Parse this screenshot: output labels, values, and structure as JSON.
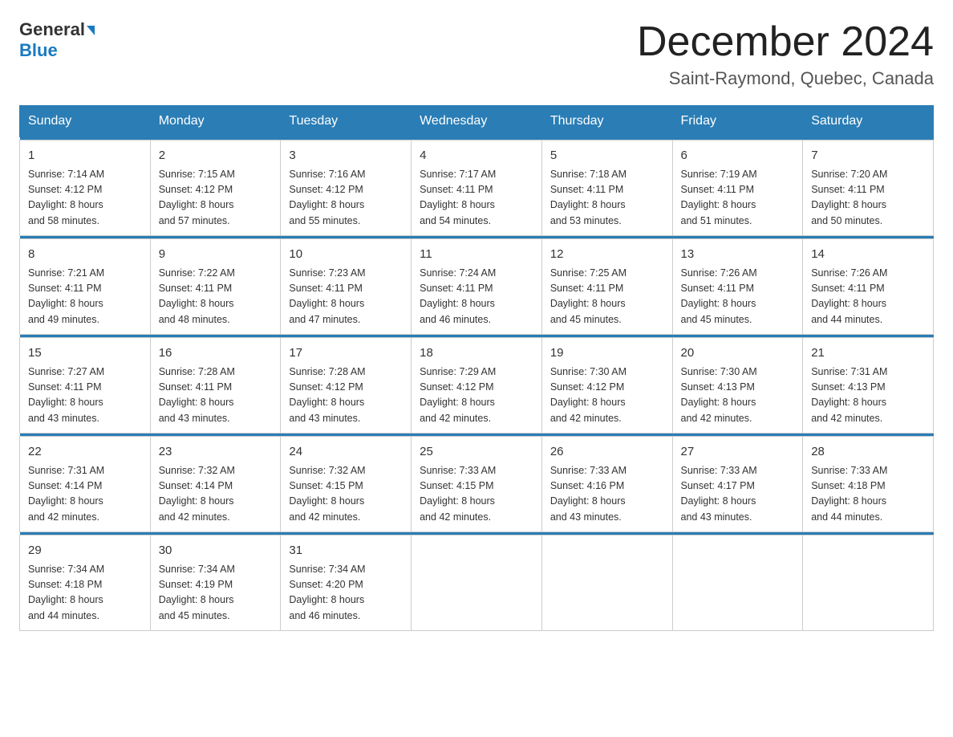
{
  "header": {
    "logo_line1": "General",
    "logo_line2": "Blue",
    "title": "December 2024",
    "subtitle": "Saint-Raymond, Quebec, Canada"
  },
  "weekdays": [
    "Sunday",
    "Monday",
    "Tuesday",
    "Wednesday",
    "Thursday",
    "Friday",
    "Saturday"
  ],
  "weeks": [
    [
      {
        "day": "1",
        "sunrise": "7:14 AM",
        "sunset": "4:12 PM",
        "daylight": "8 hours and 58 minutes."
      },
      {
        "day": "2",
        "sunrise": "7:15 AM",
        "sunset": "4:12 PM",
        "daylight": "8 hours and 57 minutes."
      },
      {
        "day": "3",
        "sunrise": "7:16 AM",
        "sunset": "4:12 PM",
        "daylight": "8 hours and 55 minutes."
      },
      {
        "day": "4",
        "sunrise": "7:17 AM",
        "sunset": "4:11 PM",
        "daylight": "8 hours and 54 minutes."
      },
      {
        "day": "5",
        "sunrise": "7:18 AM",
        "sunset": "4:11 PM",
        "daylight": "8 hours and 53 minutes."
      },
      {
        "day": "6",
        "sunrise": "7:19 AM",
        "sunset": "4:11 PM",
        "daylight": "8 hours and 51 minutes."
      },
      {
        "day": "7",
        "sunrise": "7:20 AM",
        "sunset": "4:11 PM",
        "daylight": "8 hours and 50 minutes."
      }
    ],
    [
      {
        "day": "8",
        "sunrise": "7:21 AM",
        "sunset": "4:11 PM",
        "daylight": "8 hours and 49 minutes."
      },
      {
        "day": "9",
        "sunrise": "7:22 AM",
        "sunset": "4:11 PM",
        "daylight": "8 hours and 48 minutes."
      },
      {
        "day": "10",
        "sunrise": "7:23 AM",
        "sunset": "4:11 PM",
        "daylight": "8 hours and 47 minutes."
      },
      {
        "day": "11",
        "sunrise": "7:24 AM",
        "sunset": "4:11 PM",
        "daylight": "8 hours and 46 minutes."
      },
      {
        "day": "12",
        "sunrise": "7:25 AM",
        "sunset": "4:11 PM",
        "daylight": "8 hours and 45 minutes."
      },
      {
        "day": "13",
        "sunrise": "7:26 AM",
        "sunset": "4:11 PM",
        "daylight": "8 hours and 45 minutes."
      },
      {
        "day": "14",
        "sunrise": "7:26 AM",
        "sunset": "4:11 PM",
        "daylight": "8 hours and 44 minutes."
      }
    ],
    [
      {
        "day": "15",
        "sunrise": "7:27 AM",
        "sunset": "4:11 PM",
        "daylight": "8 hours and 43 minutes."
      },
      {
        "day": "16",
        "sunrise": "7:28 AM",
        "sunset": "4:11 PM",
        "daylight": "8 hours and 43 minutes."
      },
      {
        "day": "17",
        "sunrise": "7:28 AM",
        "sunset": "4:12 PM",
        "daylight": "8 hours and 43 minutes."
      },
      {
        "day": "18",
        "sunrise": "7:29 AM",
        "sunset": "4:12 PM",
        "daylight": "8 hours and 42 minutes."
      },
      {
        "day": "19",
        "sunrise": "7:30 AM",
        "sunset": "4:12 PM",
        "daylight": "8 hours and 42 minutes."
      },
      {
        "day": "20",
        "sunrise": "7:30 AM",
        "sunset": "4:13 PM",
        "daylight": "8 hours and 42 minutes."
      },
      {
        "day": "21",
        "sunrise": "7:31 AM",
        "sunset": "4:13 PM",
        "daylight": "8 hours and 42 minutes."
      }
    ],
    [
      {
        "day": "22",
        "sunrise": "7:31 AM",
        "sunset": "4:14 PM",
        "daylight": "8 hours and 42 minutes."
      },
      {
        "day": "23",
        "sunrise": "7:32 AM",
        "sunset": "4:14 PM",
        "daylight": "8 hours and 42 minutes."
      },
      {
        "day": "24",
        "sunrise": "7:32 AM",
        "sunset": "4:15 PM",
        "daylight": "8 hours and 42 minutes."
      },
      {
        "day": "25",
        "sunrise": "7:33 AM",
        "sunset": "4:15 PM",
        "daylight": "8 hours and 42 minutes."
      },
      {
        "day": "26",
        "sunrise": "7:33 AM",
        "sunset": "4:16 PM",
        "daylight": "8 hours and 43 minutes."
      },
      {
        "day": "27",
        "sunrise": "7:33 AM",
        "sunset": "4:17 PM",
        "daylight": "8 hours and 43 minutes."
      },
      {
        "day": "28",
        "sunrise": "7:33 AM",
        "sunset": "4:18 PM",
        "daylight": "8 hours and 44 minutes."
      }
    ],
    [
      {
        "day": "29",
        "sunrise": "7:34 AM",
        "sunset": "4:18 PM",
        "daylight": "8 hours and 44 minutes."
      },
      {
        "day": "30",
        "sunrise": "7:34 AM",
        "sunset": "4:19 PM",
        "daylight": "8 hours and 45 minutes."
      },
      {
        "day": "31",
        "sunrise": "7:34 AM",
        "sunset": "4:20 PM",
        "daylight": "8 hours and 46 minutes."
      },
      null,
      null,
      null,
      null
    ]
  ],
  "labels": {
    "sunrise": "Sunrise:",
    "sunset": "Sunset:",
    "daylight": "Daylight:"
  }
}
